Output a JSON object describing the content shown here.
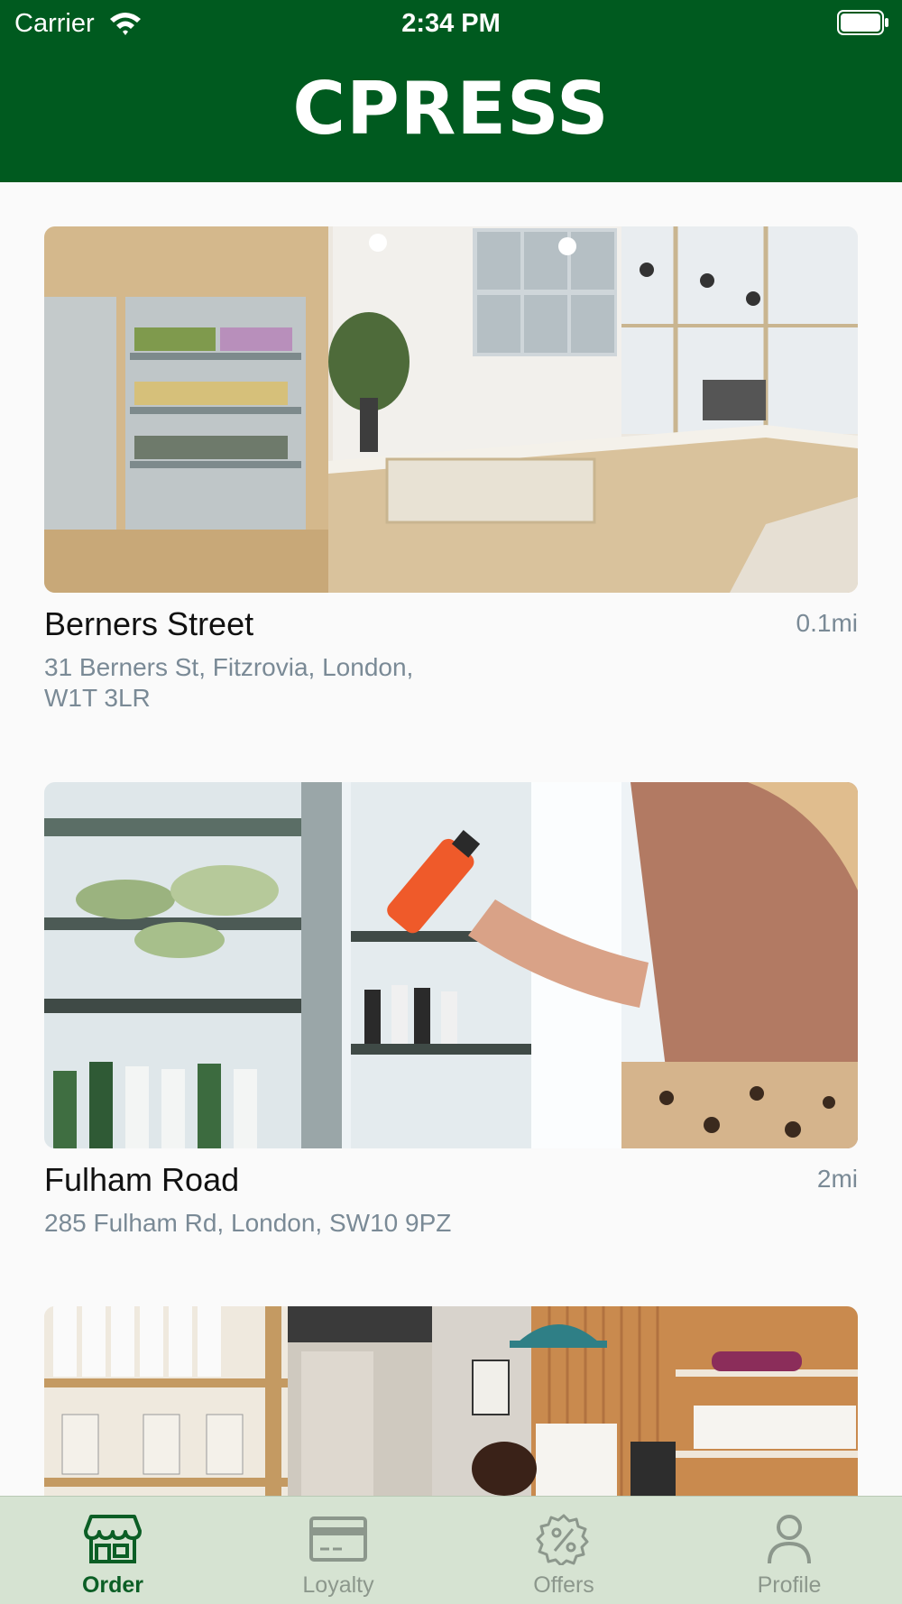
{
  "status_bar": {
    "carrier": "Carrier",
    "time": "2:34 PM"
  },
  "header": {
    "brand": "CPRESS",
    "background_color": "#005a1f"
  },
  "stores": [
    {
      "name": "Berners Street",
      "distance": "0.1mi",
      "address": "31 Berners St, Fitzrovia, London, W1T 3LR"
    },
    {
      "name": "Fulham Road",
      "distance": "2mi",
      "address": "285 Fulham Rd, London, SW10 9PZ"
    }
  ],
  "tab_bar": {
    "tabs": [
      {
        "label": "Order",
        "icon": "storefront-icon",
        "active": true
      },
      {
        "label": "Loyalty",
        "icon": "card-icon",
        "active": false
      },
      {
        "label": "Offers",
        "icon": "percent-badge-icon",
        "active": false
      },
      {
        "label": "Profile",
        "icon": "person-icon",
        "active": false
      }
    ],
    "active_color": "#0b5e25",
    "inactive_color": "#8c978c"
  }
}
